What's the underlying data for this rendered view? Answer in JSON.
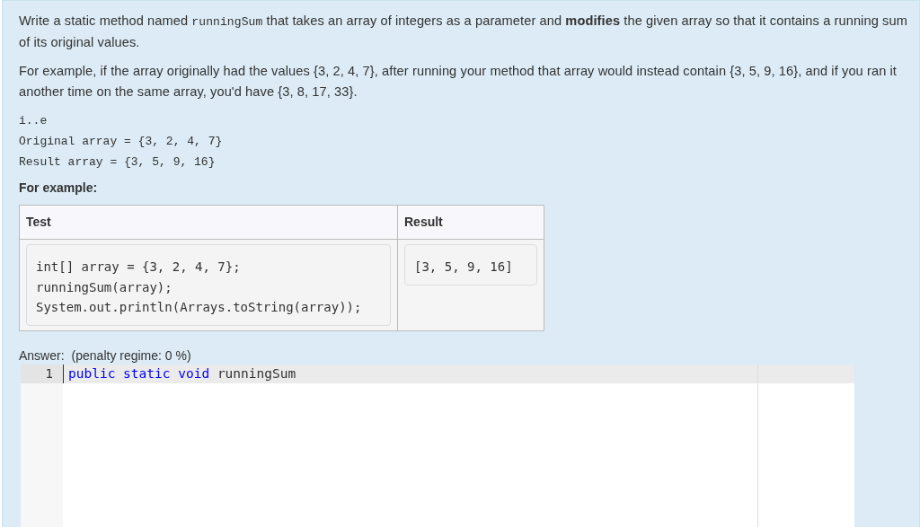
{
  "question": {
    "paragraphs": [
      [
        {
          "kind": "plain",
          "text": "Write a static method named "
        },
        {
          "kind": "code",
          "text": "runningSum"
        },
        {
          "kind": "plain",
          "text": " that takes an array of integers as a parameter and "
        },
        {
          "kind": "bold",
          "text": "modifies"
        },
        {
          "kind": "plain",
          "text": " the given array so that it contains a running sum of its original values."
        }
      ],
      [
        {
          "kind": "plain",
          "text": "For example, if the array originally had the values {3, 2, 4, 7}, after running your method that array would instead contain {3, 5, 9, 16}, and if you ran it another time on the same array, you'd have {3, 8, 17, 33}."
        }
      ]
    ],
    "code_lines": [
      "i..e",
      "Original array = {3, 2, 4, 7}",
      "Result array = {3, 5, 9, 16}"
    ],
    "example_heading": "For example:",
    "example_table": {
      "columns": [
        "Test",
        "Result"
      ],
      "rows": [
        {
          "test": [
            "int[] array = {3, 2, 4, 7};",
            "runningSum(array);",
            "System.out.println(Arrays.toString(array));"
          ],
          "result": [
            "[3, 5, 9, 16]"
          ]
        }
      ]
    }
  },
  "answer": {
    "label": "Answer:",
    "penalty": "(penalty regime: 0 %)",
    "editor": {
      "lines": [
        {
          "number": "1",
          "active": true,
          "tokens": [
            {
              "kind": "keyword",
              "text": "public"
            },
            {
              "kind": "keyword",
              "text": "static"
            },
            {
              "kind": "keyword",
              "text": "void"
            },
            {
              "kind": "plain",
              "text": "runningSum"
            }
          ]
        }
      ]
    }
  }
}
